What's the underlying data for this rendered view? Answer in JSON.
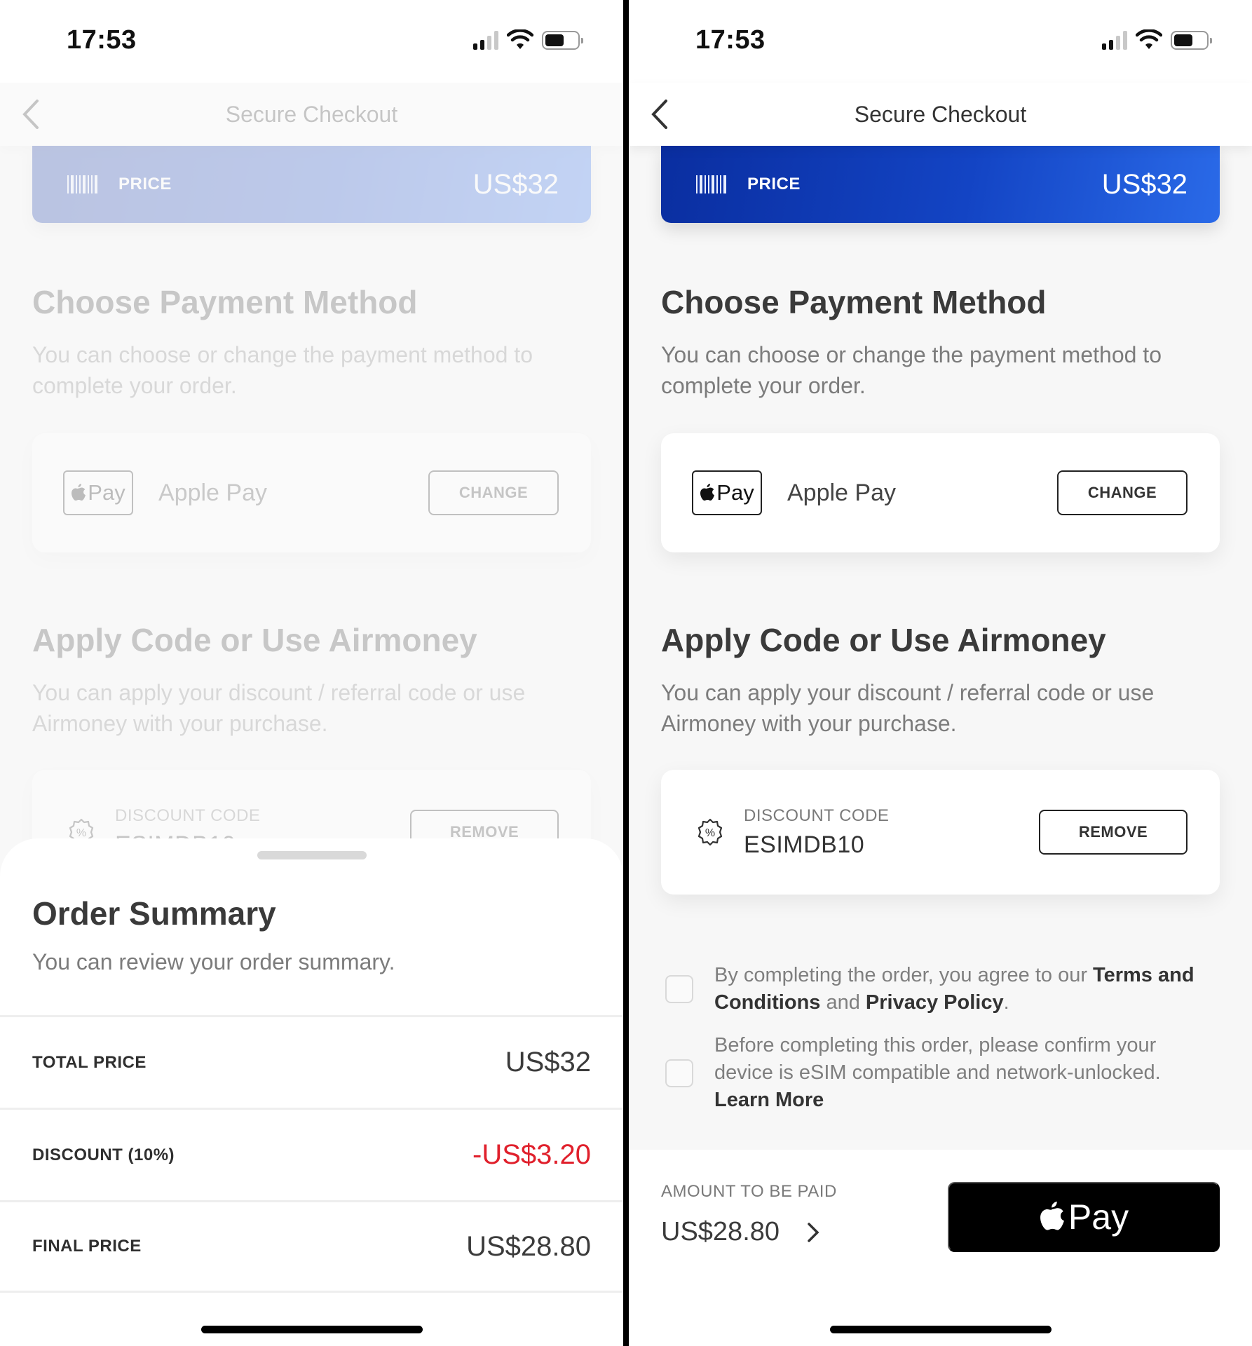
{
  "status_bar": {
    "time": "17:53",
    "icons": [
      "cellular-signal-icon",
      "wifi-icon",
      "battery-icon"
    ]
  },
  "nav": {
    "title": "Secure Checkout",
    "back_icon": "chevron-left-icon"
  },
  "price_banner": {
    "icon": "barcode-icon",
    "label": "PRICE",
    "value": "US$32",
    "gradient": [
      "#0a2ea0",
      "#2a6ae8"
    ]
  },
  "payment_section": {
    "title": "Choose Payment Method",
    "description": "You can choose or change the payment method to complete your order.",
    "method_logo": "Pay",
    "method_name": "Apple Pay",
    "change_label": "CHANGE"
  },
  "discount_section": {
    "title": "Apply Code or Use Airmoney",
    "description": "You can apply your discount / referral code or use Airmoney with your purchase.",
    "code_label": "DISCOUNT CODE",
    "code_value": "ESIMDB10",
    "remove_label": "REMOVE"
  },
  "agreements": {
    "terms": {
      "prefix": "By completing the order, you agree to our ",
      "terms_link": "Terms and Conditions",
      "middle": " and ",
      "privacy_link": "Privacy Policy",
      "suffix": ".",
      "checked": false
    },
    "device": {
      "text": "Before completing this order, please confirm your device is eSIM compatible and network-unlocked. ",
      "link": "Learn More",
      "checked": false
    }
  },
  "pay_bar": {
    "amount_label": "AMOUNT TO BE PAID",
    "amount_value": "US$28.80",
    "button_label": "Pay"
  },
  "order_summary": {
    "title": "Order Summary",
    "description": "You can review your order summary.",
    "rows": [
      {
        "label": "TOTAL PRICE",
        "value": "US$32"
      },
      {
        "label": "DISCOUNT (10%)",
        "value": "-US$3.20",
        "color": "#e0202c"
      },
      {
        "label": "FINAL PRICE",
        "value": "US$28.80"
      }
    ]
  }
}
